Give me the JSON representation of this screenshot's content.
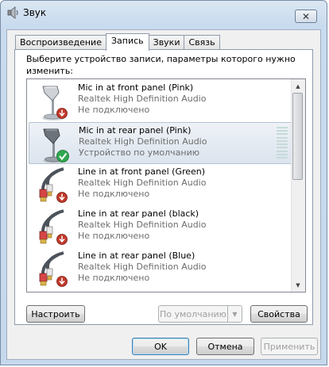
{
  "window": {
    "title": "Звук",
    "close_glyph": "✕",
    "title_icon": "speaker-icon"
  },
  "tabs": [
    {
      "label": "Воспроизведение",
      "active": false
    },
    {
      "label": "Запись",
      "active": true
    },
    {
      "label": "Звуки",
      "active": false
    },
    {
      "label": "Связь",
      "active": false
    }
  ],
  "recording": {
    "instruction": "Выберите устройство записи, параметры которого нужно изменить:",
    "devices": [
      {
        "name": "Mic in at front panel (Pink)",
        "driver": "Realtek High Definition Audio",
        "status": "Не подключено",
        "icon": "microphone-icon",
        "badge": "disconnected-arrow-icon",
        "selected": false
      },
      {
        "name": "Mic in at rear panel (Pink)",
        "driver": "Realtek High Definition Audio",
        "status": "Устройство по умолчанию",
        "icon": "microphone-icon",
        "badge": "default-check-icon",
        "selected": true
      },
      {
        "name": "Line in at front panel (Green)",
        "driver": "Realtek High Definition Audio",
        "status": "Не подключено",
        "icon": "line-in-cable-icon",
        "badge": "disconnected-arrow-icon",
        "selected": false
      },
      {
        "name": "Line in at rear panel (black)",
        "driver": "Realtek High Definition Audio",
        "status": "Не подключено",
        "icon": "line-in-cable-icon",
        "badge": "disconnected-arrow-icon",
        "selected": false
      },
      {
        "name": "Line in at rear panel (Blue)",
        "driver": "Realtek High Definition Audio",
        "status": "Не подключено",
        "icon": "line-in-cable-icon",
        "badge": "disconnected-arrow-icon",
        "selected": false
      }
    ]
  },
  "buttons": {
    "configure": "Настроить",
    "set_default": "По умолчанию",
    "properties": "Свойства",
    "ok": "OK",
    "cancel": "Отмена",
    "apply": "Применить"
  },
  "colors": {
    "disconnected_badge": "#c0392b",
    "default_badge": "#2fa84f",
    "selected_row": "#dce4ee",
    "secondary_text": "#6d6d6d"
  }
}
